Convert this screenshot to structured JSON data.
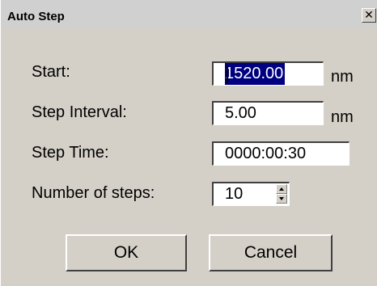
{
  "window": {
    "title": "Auto Step",
    "close_glyph": "✕"
  },
  "form": {
    "start": {
      "label": "Start:",
      "value": "1520.00",
      "unit": "nm"
    },
    "step_interval": {
      "label": "Step Interval:",
      "value": "5.00",
      "unit": "nm"
    },
    "step_time": {
      "label": "Step Time:",
      "value": "0000:00:30"
    },
    "number_of_steps": {
      "label": "Number of steps:",
      "value": "10"
    }
  },
  "buttons": {
    "ok_label": "OK",
    "cancel_label": "Cancel"
  }
}
